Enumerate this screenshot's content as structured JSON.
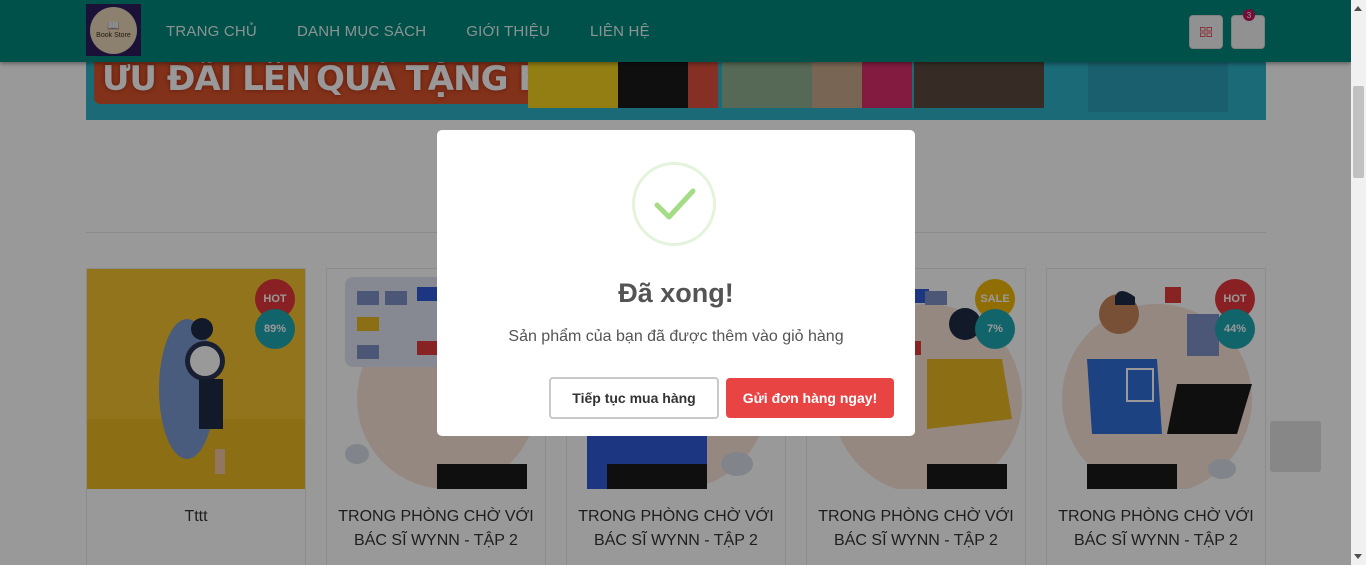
{
  "header": {
    "logo_text": "Book Store",
    "nav": [
      "TRANG CHỦ",
      "DANH MỤC SÁCH",
      "GIỚI THIỆU",
      "LIÊN HỆ"
    ],
    "cart_count": "3"
  },
  "banner": {
    "promo_1": "ƯU ĐÃI LÊN ĐẾN 50%",
    "promo_2": "QUÀ TẶNG HẤP DẪN"
  },
  "products": [
    {
      "title_line1": "Tttt",
      "title_line2": "",
      "tag": "HOT",
      "percent": "89%"
    },
    {
      "title_line1": "TRONG PHÒNG CHỜ VỚI",
      "title_line2": "BÁC SĨ WYNN - TẬP 2",
      "tag": "",
      "percent": ""
    },
    {
      "title_line1": "TRONG PHÒNG CHỜ VỚI",
      "title_line2": "BÁC SĨ WYNN - TẬP 2",
      "tag": "",
      "percent": ""
    },
    {
      "title_line1": "TRONG PHÒNG CHỜ VỚI",
      "title_line2": "BÁC SĨ WYNN - TẬP 2",
      "tag": "SALE",
      "percent": "7%"
    },
    {
      "title_line1": "TRONG PHÒNG CHỜ VỚI",
      "title_line2": "BÁC SĨ WYNN - TẬP 2",
      "tag": "HOT",
      "percent": "44%"
    }
  ],
  "modal": {
    "title": "Đã xong!",
    "message": "Sản phẩm của bạn đã được thêm vào giỏ hàng",
    "continue_label": "Tiếp tục mua hàng",
    "send_label": "Gửi đơn hàng ngay!"
  },
  "colors": {
    "header_bg": "#00877a",
    "confirm_button": "#e84444",
    "success_check": "#a5dc86",
    "hot_badge": "#e5373c",
    "sale_badge": "#f2b705",
    "percent_badge": "#1ea7b3"
  }
}
